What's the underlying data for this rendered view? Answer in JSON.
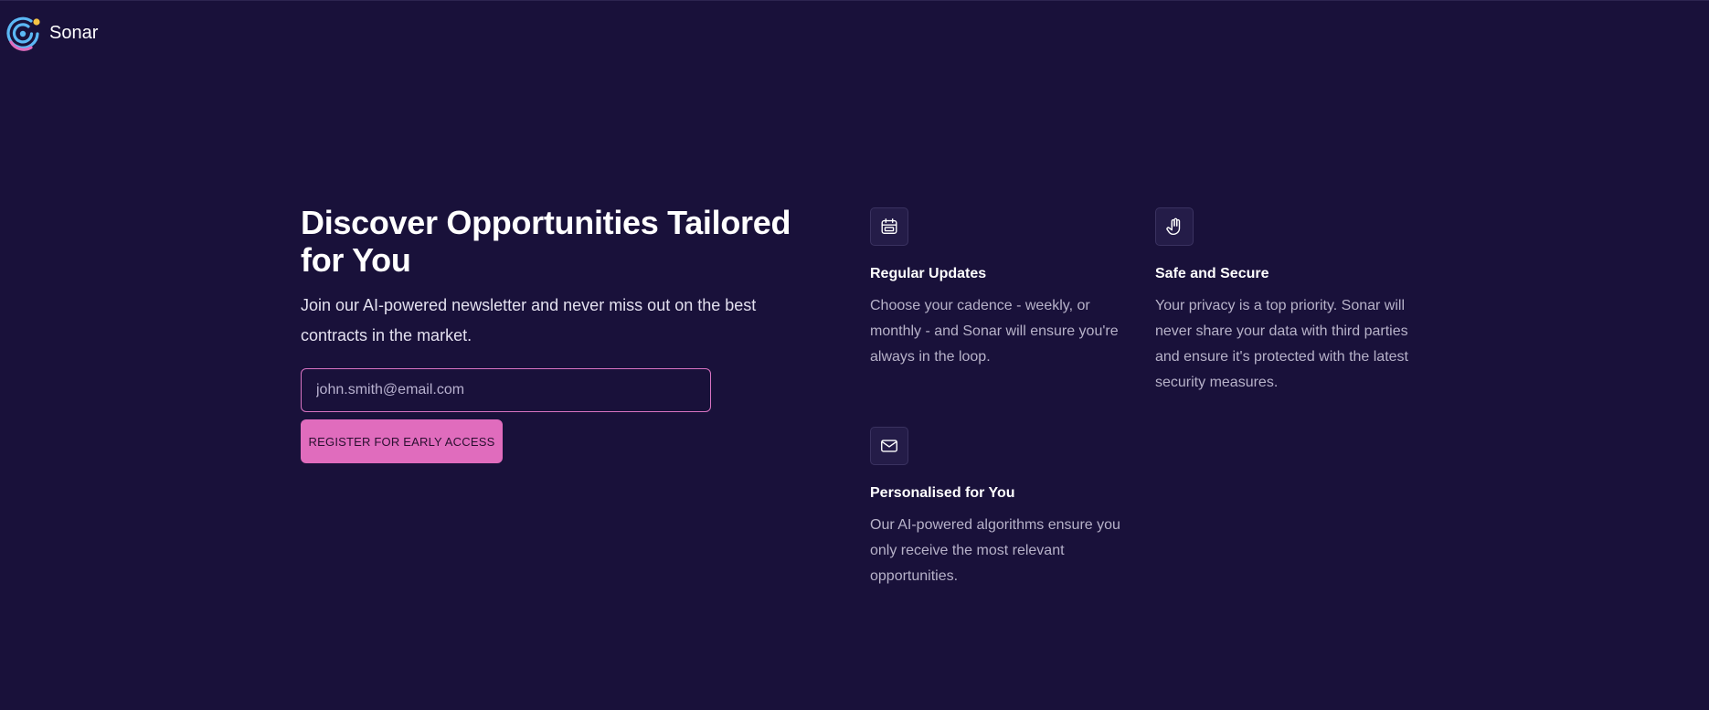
{
  "brand": {
    "name": "Sonar",
    "logo_icon": "sonar-logo-icon",
    "colors": {
      "blue": "#5bb8f5",
      "pink": "#e06cbd",
      "gold": "#f6c445"
    }
  },
  "hero": {
    "title": "Discover Opportunities Tailored for You",
    "subtitle": "Join our AI-powered newsletter and never miss out on the best contracts in the market.",
    "email_placeholder": "john.smith@email.com",
    "email_value": "",
    "cta_label": "REGISTER FOR EARLY ACCESS"
  },
  "features": [
    {
      "icon": "calendar-icon",
      "title": "Regular Updates",
      "description": "Choose your cadence - weekly, or monthly - and Sonar will ensure you're always in the loop."
    },
    {
      "icon": "hand-icon",
      "title": "Safe and Secure",
      "description": "Your privacy is a top priority. Sonar will never share your data with third parties and ensure it's protected with the latest security measures."
    },
    {
      "icon": "envelope-icon",
      "title": "Personalised for You",
      "description": "Our AI-powered algorithms ensure you only receive the most relevant opportunities."
    }
  ],
  "colors": {
    "background": "#19113a",
    "accent": "#e06cbd",
    "icon_box": "#241c48",
    "muted_text": "#b7b2c9"
  }
}
